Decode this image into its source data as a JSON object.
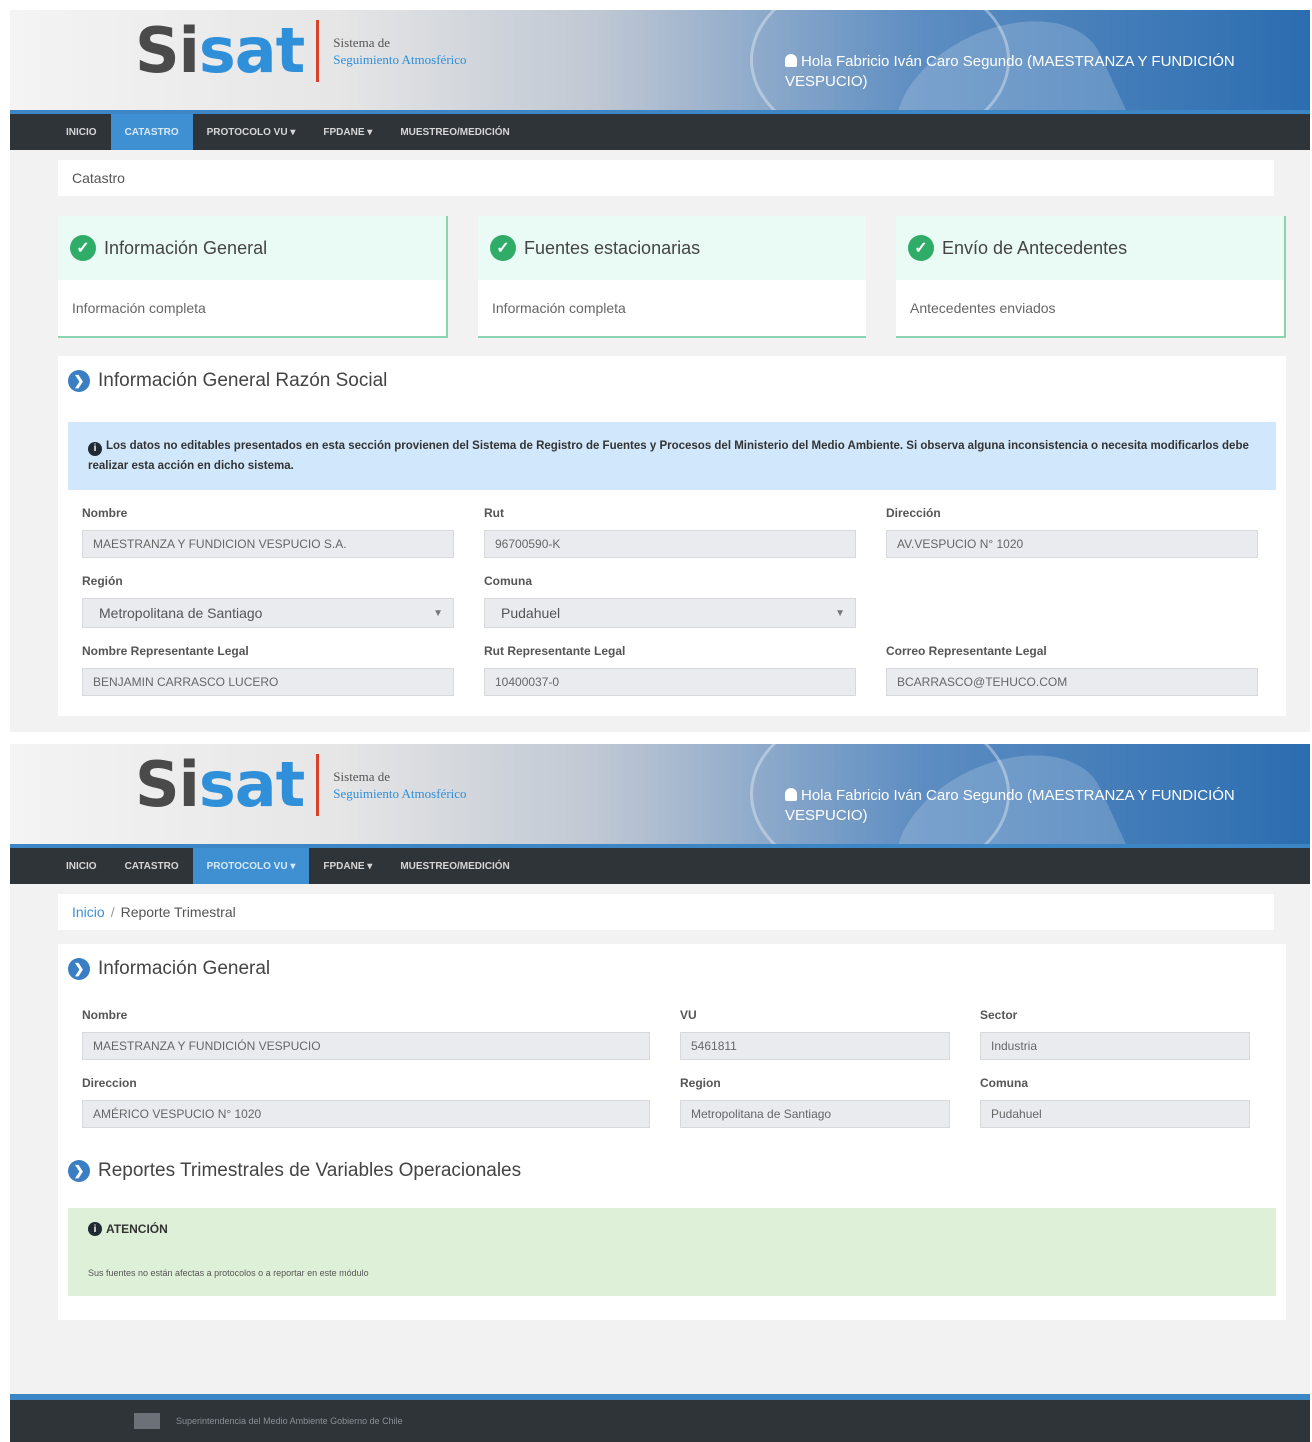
{
  "brand": {
    "logo_part1": "Si",
    "logo_part2": "sat",
    "subtitle_line1": "Sistema de",
    "subtitle_line2": "Seguimiento Atmosférico",
    "user": "Hola Fabricio Iván Caro Segundo (MAESTRANZA Y FUNDICIÓN VESPUCIO)"
  },
  "nav": {
    "items": [
      "INICIO",
      "CATASTRO",
      "PROTOCOLO VU",
      "FPDANE",
      "MUESTREO/MEDICIÓN"
    ],
    "dropdown_mark": "▾"
  },
  "screen1": {
    "breadcrumb": "Catastro",
    "cards": [
      {
        "title": "Información General",
        "status": "Información completa"
      },
      {
        "title": "Fuentes estacionarias",
        "status": "Información completa"
      },
      {
        "title": "Envío de Antecedentes",
        "status": "Antecedentes enviados"
      }
    ],
    "panel_title": "Información General Razón Social",
    "notice": "Los datos no editables presentados en esta sección provienen del Sistema de Registro de Fuentes y Procesos del Ministerio del Medio Ambiente. Si observa alguna inconsistencia o necesita modificarlos debe realizar esta acción en dicho sistema.",
    "fields": {
      "nombre_label": "Nombre",
      "nombre_value": "MAESTRANZA Y FUNDICION VESPUCIO S.A.",
      "rut_label": "Rut",
      "rut_value": "96700590-K",
      "direccion_label": "Dirección",
      "direccion_value": "AV.VESPUCIO N° 1020",
      "region_label": "Región",
      "region_value": "Metropolitana de Santiago",
      "comuna_label": "Comuna",
      "comuna_value": "Pudahuel",
      "rep_nombre_label": "Nombre Representante Legal",
      "rep_nombre_value": "BENJAMIN CARRASCO LUCERO",
      "rep_rut_label": "Rut Representante Legal",
      "rep_rut_value": "10400037-0",
      "rep_correo_label": "Correo Representante Legal",
      "rep_correo_value": "BCARRASCO@TEHUCO.COM"
    }
  },
  "screen2": {
    "breadcrumb_home": "Inicio",
    "breadcrumb_sep": "/",
    "breadcrumb_current": "Reporte Trimestral",
    "panel_title": "Información General",
    "fields": {
      "nombre_label": "Nombre",
      "nombre_value": "MAESTRANZA Y FUNDICIÓN VESPUCIO",
      "vu_label": "VU",
      "vu_value": "5461811",
      "sector_label": "Sector",
      "sector_value": "Industria",
      "direccion_label": "Direccion",
      "direccion_value": "AMÉRICO VESPUCIO N° 1020",
      "region_label": "Region",
      "region_value": "Metropolitana de Santiago",
      "comuna_label": "Comuna",
      "comuna_value": "Pudahuel"
    },
    "reports_title": "Reportes Trimestrales de Variables Operacionales",
    "alert_title": "ATENCIÓN",
    "alert_body": "Sus fuentes no están afectas a protocolos o a reportar en este módulo"
  },
  "footer": {
    "text": "Superintendencia del Medio Ambiente Gobierno de Chile"
  },
  "colors": {
    "nav_bg": "#2f3439",
    "nav_active": "#3f8fd3",
    "success": "#2eac68",
    "info_bg": "#d1e7fb",
    "success_bg": "#dff0d8"
  }
}
